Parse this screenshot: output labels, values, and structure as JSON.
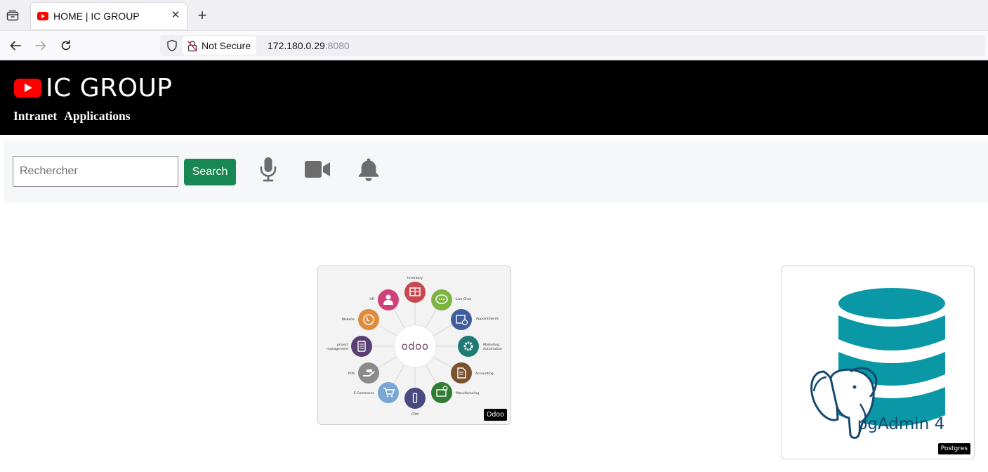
{
  "browser": {
    "tab_title": "HOME | IC GROUP",
    "security_label": "Not Secure",
    "url_host": "172.180.0.29",
    "url_port": ":8080"
  },
  "header": {
    "brand": "IC GROUP",
    "menu": [
      "Intranet",
      "Applications"
    ]
  },
  "search": {
    "placeholder": "Rechercher",
    "button_label": "Search"
  },
  "toolbar_icons": [
    "microphone-icon",
    "video-camera-icon",
    "bell-icon"
  ],
  "apps": [
    {
      "label": "Odoo",
      "logo": "odoo",
      "modules": [
        "Inventory",
        "Live Chat",
        "Appointments",
        "Marketing",
        "Automation",
        "Accounting",
        "Manufacturing",
        "CRM",
        "E-Commerce",
        "POS",
        "project",
        "management",
        "Website",
        "HR"
      ]
    },
    {
      "label": "Postgres",
      "logo_text": "pgAdmin 4"
    }
  ],
  "colors": {
    "header_bg": "#000000",
    "brand_red": "#ff0000",
    "search_button": "#198754",
    "toolbar_bg": "#f6f7f9",
    "pg_teal": "#0a97a6",
    "pg_navy": "#17496f"
  }
}
